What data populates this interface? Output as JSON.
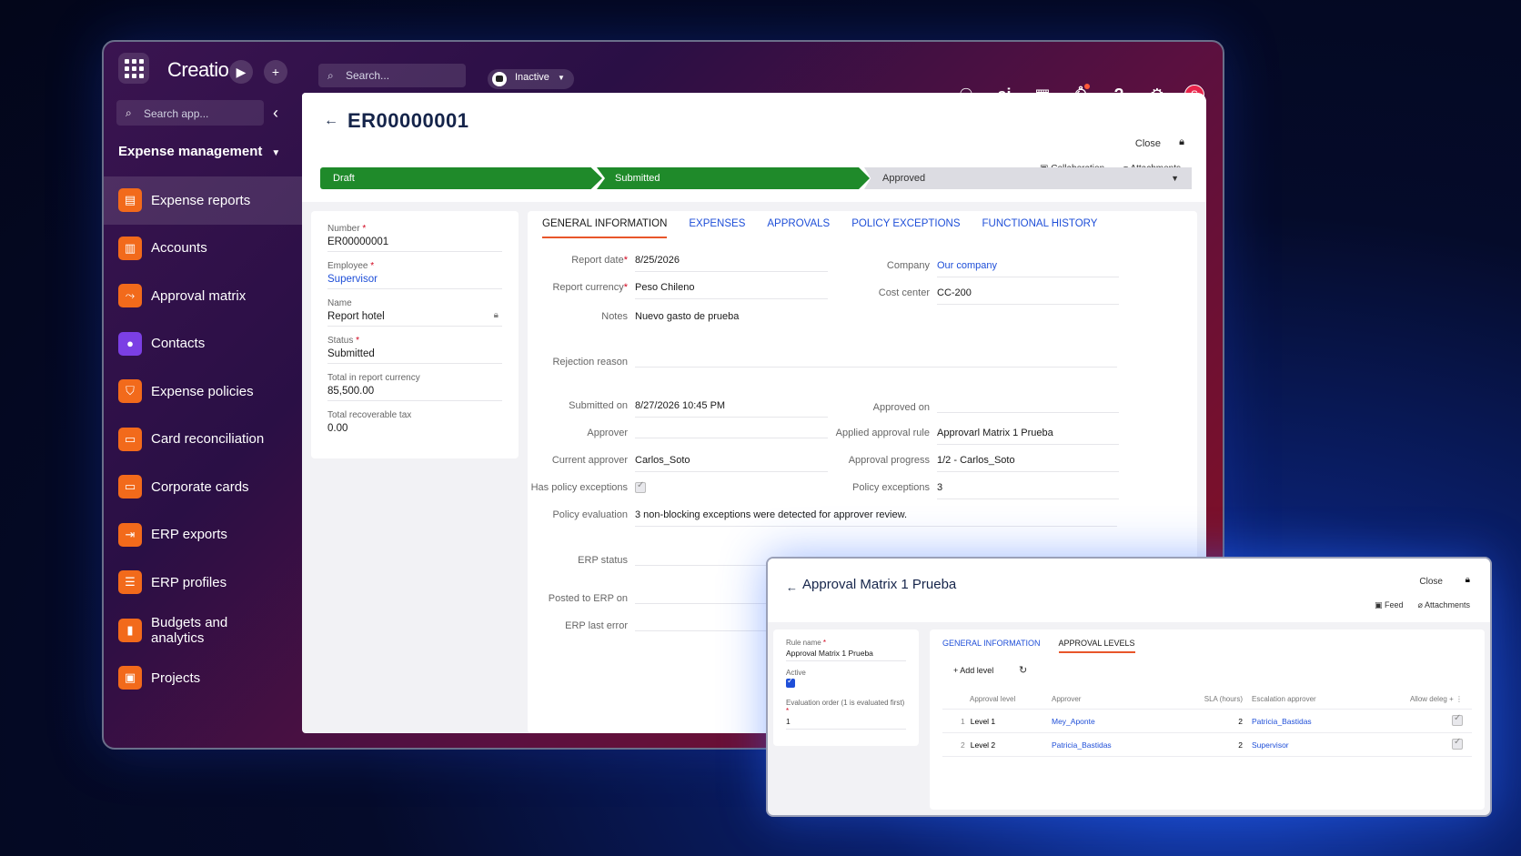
{
  "topbar": {
    "logo": "Creatio",
    "search_placeholder": "Search...",
    "status": "Inactive",
    "ai_label": "ai",
    "avatar_initial": "S"
  },
  "sidebar": {
    "search_placeholder": "Search app...",
    "app_title": "Expense management",
    "items": [
      {
        "label": "Expense reports",
        "icon": "document-icon"
      },
      {
        "label": "Accounts",
        "icon": "building-icon"
      },
      {
        "label": "Approval matrix",
        "icon": "flow-icon"
      },
      {
        "label": "Contacts",
        "icon": "person-icon"
      },
      {
        "label": "Expense policies",
        "icon": "shield-icon"
      },
      {
        "label": "Card reconciliation",
        "icon": "card-icon"
      },
      {
        "label": "Corporate cards",
        "icon": "card-icon"
      },
      {
        "label": "ERP exports",
        "icon": "export-icon"
      },
      {
        "label": "ERP profiles",
        "icon": "sliders-icon"
      },
      {
        "label": "Budgets and analytics",
        "icon": "chart-icon"
      },
      {
        "label": "Projects",
        "icon": "briefcase-icon"
      }
    ]
  },
  "record": {
    "title": "ER00000001",
    "close_label": "Close",
    "collaboration_label": "Collaboration",
    "attachments_label": "Attachments",
    "stages": [
      "Draft",
      "Submitted",
      "Approved"
    ]
  },
  "summary": {
    "number_label": "Number",
    "number_value": "ER00000001",
    "employee_label": "Employee",
    "employee_value": "Supervisor",
    "name_label": "Name",
    "name_value": "Report hotel",
    "status_label": "Status",
    "status_value": "Submitted",
    "total_label": "Total in report currency",
    "total_value": "85,500.00",
    "tax_label": "Total recoverable tax",
    "tax_value": "0.00"
  },
  "tabs": [
    "GENERAL INFORMATION",
    "EXPENSES",
    "APPROVALS",
    "POLICY EXCEPTIONS",
    "FUNCTIONAL HISTORY"
  ],
  "general": {
    "report_date_label": "Report date",
    "report_date": "8/25/2026",
    "currency_label": "Report currency",
    "currency": "Peso Chileno",
    "notes_label": "Notes",
    "notes": "Nuevo gasto de prueba",
    "rejection_label": "Rejection reason",
    "submitted_label": "Submitted on",
    "submitted": "8/27/2026 10:45 PM",
    "approver_label": "Approver",
    "current_approver_label": "Current approver",
    "current_approver": "Carlos_Soto",
    "has_exceptions_label": "Has policy exceptions",
    "policy_eval_label": "Policy evaluation",
    "policy_eval": "3 non-blocking exceptions were detected for approver review.",
    "erp_status_label": "ERP status",
    "posted_label": "Posted to ERP on",
    "erp_error_label": "ERP last error",
    "company_label": "Company",
    "company": "Our company",
    "cost_center_label": "Cost center",
    "cost_center": "CC-200",
    "approved_on_label": "Approved on",
    "rule_label": "Applied approval rule",
    "rule": "Approvarl Matrix 1 Prueba",
    "progress_label": "Approval progress",
    "progress": "1/2 - Carlos_Soto",
    "exceptions_label": "Policy exceptions",
    "exceptions": "3"
  },
  "sub": {
    "title": "Approval Matrix 1 Prueba",
    "close_label": "Close",
    "feed_label": "Feed",
    "attachments_label": "Attachments",
    "rule_name_label": "Rule name",
    "rule_name": "Approval Matrix 1 Prueba",
    "active_label": "Active",
    "order_label": "Evaluation order (1 is evaluated first)",
    "order_value": "1",
    "tabs": [
      "GENERAL INFORMATION",
      "APPROVAL LEVELS"
    ],
    "add_level": "+ Add level",
    "columns": [
      "Approval level",
      "Approver",
      "SLA (hours)",
      "Escalation approver",
      "Allow deleg"
    ],
    "rows": [
      {
        "n": "1",
        "level": "Level 1",
        "approver": "Mey_Aponte",
        "sla": "2",
        "escalation": "Patricia_Bastidas"
      },
      {
        "n": "2",
        "level": "Level 2",
        "approver": "Patricia_Bastidas",
        "sla": "2",
        "escalation": "Supervisor"
      }
    ]
  }
}
